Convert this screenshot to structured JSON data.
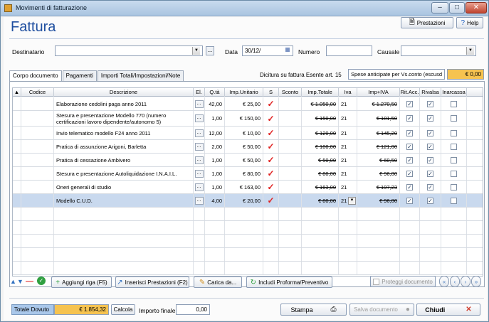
{
  "window": {
    "title": "Movimenti di fatturazione"
  },
  "header": {
    "title": "Fattura",
    "prestazioni_label": "Prestazioni",
    "help_label": "Help"
  },
  "form": {
    "destinatario_label": "Destinatario",
    "destinatario_value": "",
    "data_label": "Data",
    "data_value": "30/12/",
    "numero_label": "Numero",
    "numero_value": "",
    "causale_label": "Causale",
    "causale_value": ""
  },
  "tabs": [
    "Corpo documento",
    "Pagamenti",
    "Importi Totali/Impostazioni/Note"
  ],
  "dicitura": {
    "label": "Dicitura su fattura Esente art. 15",
    "value": "Spese anticipate per Vs.conto (escusd",
    "amount": "€ 0,00"
  },
  "table": {
    "columns": [
      "Codice",
      "Descrizione",
      "El.",
      "Q.tà",
      "Imp.Unitario",
      "S",
      "Sconto",
      "Imp.Totale",
      "Iva",
      "Imp+IVA",
      "Rit.Acc.",
      "Rivalsa",
      "Inarcassa"
    ],
    "rows": [
      {
        "desc": "Elaborazione cedolini paga anno 2011",
        "el": "...",
        "qta": "42,00",
        "unit": "€ 25,00",
        "tot": "€ 1.050,00",
        "iva": "21",
        "impiva": "€ 1.270,50",
        "rit": "✓",
        "riv": "✓",
        "ina": ""
      },
      {
        "desc": "Stesura e presentazione Modello 770 (numero certificazioni lavoro dipendente/autonomo 5)",
        "el": "...",
        "qta": "1,00",
        "unit": "€ 150,00",
        "tot": "€ 150,00",
        "iva": "21",
        "impiva": "€ 181,50",
        "rit": "✓",
        "riv": "✓",
        "ina": ""
      },
      {
        "desc": "Invio telematico modello F24 anno 2011",
        "el": "...",
        "qta": "12,00",
        "unit": "€ 10,00",
        "tot": "€ 120,00",
        "iva": "21",
        "impiva": "€ 145,20",
        "rit": "✓",
        "riv": "✓",
        "ina": ""
      },
      {
        "desc": "Pratica di assunzione Arigoni, Barletta",
        "el": "...",
        "qta": "2,00",
        "unit": "€ 50,00",
        "tot": "€ 100,00",
        "iva": "21",
        "impiva": "€ 121,00",
        "rit": "✓",
        "riv": "✓",
        "ina": ""
      },
      {
        "desc": "Pratica di cessazione Ambivero",
        "el": "...",
        "qta": "1,00",
        "unit": "€ 50,00",
        "tot": "€ 50,00",
        "iva": "21",
        "impiva": "€ 60,50",
        "rit": "✓",
        "riv": "✓",
        "ina": ""
      },
      {
        "desc": "Stesura e presentazione Autoliquidazione I.N.A.I.L.",
        "el": "...",
        "qta": "1,00",
        "unit": "€ 80,00",
        "tot": "€ 80,00",
        "iva": "21",
        "impiva": "€ 96,80",
        "rit": "✓",
        "riv": "✓",
        "ina": ""
      },
      {
        "desc": "Oneri generali di studio",
        "el": "...",
        "qta": "1,00",
        "unit": "€ 163,00",
        "tot": "€ 163,00",
        "iva": "21",
        "impiva": "€ 197,23",
        "rit": "✓",
        "riv": "✓",
        "ina": ""
      },
      {
        "desc": "Modello C.U.D.",
        "el": "...",
        "qta": "4,00",
        "unit": "€ 20,00",
        "tot": "€ 80,00",
        "iva": "21",
        "impiva": "€ 96,80",
        "rit": "✓",
        "riv": "✓",
        "ina": ""
      }
    ]
  },
  "toolbar": {
    "add_row": "Aggiungi riga (F5)",
    "insert_prest": "Inserisci Prestazioni (F2)",
    "load": "Carica da...",
    "include": "Includi Proforma/Preventivo",
    "protect": "Proteggi documento"
  },
  "footer": {
    "totale_label": "Totale Dovuto",
    "totale_value": "€ 1.854,32",
    "calcola": "Calcola",
    "importo_label": "Importo finale",
    "importo_value": "0,00",
    "stampa": "Stampa",
    "salva": "Salva documento",
    "chiudi": "Chiudi"
  }
}
